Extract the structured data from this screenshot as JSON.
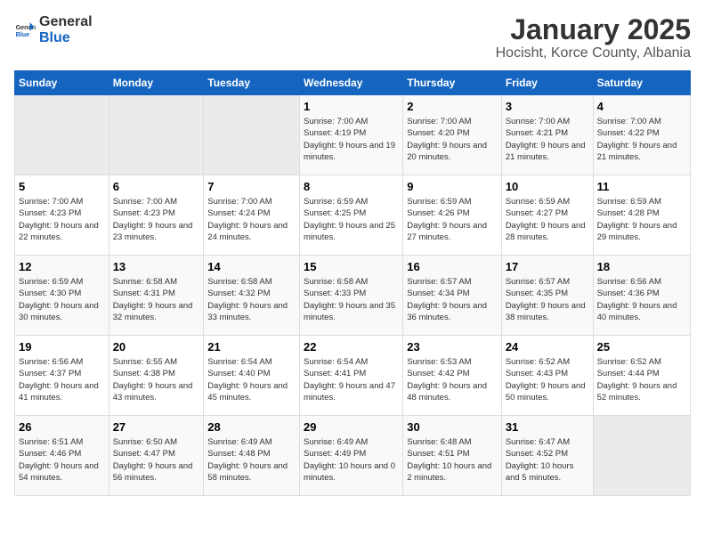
{
  "logo": {
    "general": "General",
    "blue": "Blue"
  },
  "header": {
    "title": "January 2025",
    "subtitle": "Hocisht, Korce County, Albania"
  },
  "weekdays": [
    "Sunday",
    "Monday",
    "Tuesday",
    "Wednesday",
    "Thursday",
    "Friday",
    "Saturday"
  ],
  "weeks": [
    [
      {
        "day": "",
        "empty": true
      },
      {
        "day": "",
        "empty": true
      },
      {
        "day": "",
        "empty": true
      },
      {
        "day": "1",
        "sunrise": "7:00 AM",
        "sunset": "4:19 PM",
        "daylight": "9 hours and 19 minutes."
      },
      {
        "day": "2",
        "sunrise": "7:00 AM",
        "sunset": "4:20 PM",
        "daylight": "9 hours and 20 minutes."
      },
      {
        "day": "3",
        "sunrise": "7:00 AM",
        "sunset": "4:21 PM",
        "daylight": "9 hours and 21 minutes."
      },
      {
        "day": "4",
        "sunrise": "7:00 AM",
        "sunset": "4:22 PM",
        "daylight": "9 hours and 21 minutes."
      }
    ],
    [
      {
        "day": "5",
        "sunrise": "7:00 AM",
        "sunset": "4:23 PM",
        "daylight": "9 hours and 22 minutes."
      },
      {
        "day": "6",
        "sunrise": "7:00 AM",
        "sunset": "4:23 PM",
        "daylight": "9 hours and 23 minutes."
      },
      {
        "day": "7",
        "sunrise": "7:00 AM",
        "sunset": "4:24 PM",
        "daylight": "9 hours and 24 minutes."
      },
      {
        "day": "8",
        "sunrise": "6:59 AM",
        "sunset": "4:25 PM",
        "daylight": "9 hours and 25 minutes."
      },
      {
        "day": "9",
        "sunrise": "6:59 AM",
        "sunset": "4:26 PM",
        "daylight": "9 hours and 27 minutes."
      },
      {
        "day": "10",
        "sunrise": "6:59 AM",
        "sunset": "4:27 PM",
        "daylight": "9 hours and 28 minutes."
      },
      {
        "day": "11",
        "sunrise": "6:59 AM",
        "sunset": "4:28 PM",
        "daylight": "9 hours and 29 minutes."
      }
    ],
    [
      {
        "day": "12",
        "sunrise": "6:59 AM",
        "sunset": "4:30 PM",
        "daylight": "9 hours and 30 minutes."
      },
      {
        "day": "13",
        "sunrise": "6:58 AM",
        "sunset": "4:31 PM",
        "daylight": "9 hours and 32 minutes."
      },
      {
        "day": "14",
        "sunrise": "6:58 AM",
        "sunset": "4:32 PM",
        "daylight": "9 hours and 33 minutes."
      },
      {
        "day": "15",
        "sunrise": "6:58 AM",
        "sunset": "4:33 PM",
        "daylight": "9 hours and 35 minutes."
      },
      {
        "day": "16",
        "sunrise": "6:57 AM",
        "sunset": "4:34 PM",
        "daylight": "9 hours and 36 minutes."
      },
      {
        "day": "17",
        "sunrise": "6:57 AM",
        "sunset": "4:35 PM",
        "daylight": "9 hours and 38 minutes."
      },
      {
        "day": "18",
        "sunrise": "6:56 AM",
        "sunset": "4:36 PM",
        "daylight": "9 hours and 40 minutes."
      }
    ],
    [
      {
        "day": "19",
        "sunrise": "6:56 AM",
        "sunset": "4:37 PM",
        "daylight": "9 hours and 41 minutes."
      },
      {
        "day": "20",
        "sunrise": "6:55 AM",
        "sunset": "4:38 PM",
        "daylight": "9 hours and 43 minutes."
      },
      {
        "day": "21",
        "sunrise": "6:54 AM",
        "sunset": "4:40 PM",
        "daylight": "9 hours and 45 minutes."
      },
      {
        "day": "22",
        "sunrise": "6:54 AM",
        "sunset": "4:41 PM",
        "daylight": "9 hours and 47 minutes."
      },
      {
        "day": "23",
        "sunrise": "6:53 AM",
        "sunset": "4:42 PM",
        "daylight": "9 hours and 48 minutes."
      },
      {
        "day": "24",
        "sunrise": "6:52 AM",
        "sunset": "4:43 PM",
        "daylight": "9 hours and 50 minutes."
      },
      {
        "day": "25",
        "sunrise": "6:52 AM",
        "sunset": "4:44 PM",
        "daylight": "9 hours and 52 minutes."
      }
    ],
    [
      {
        "day": "26",
        "sunrise": "6:51 AM",
        "sunset": "4:46 PM",
        "daylight": "9 hours and 54 minutes."
      },
      {
        "day": "27",
        "sunrise": "6:50 AM",
        "sunset": "4:47 PM",
        "daylight": "9 hours and 56 minutes."
      },
      {
        "day": "28",
        "sunrise": "6:49 AM",
        "sunset": "4:48 PM",
        "daylight": "9 hours and 58 minutes."
      },
      {
        "day": "29",
        "sunrise": "6:49 AM",
        "sunset": "4:49 PM",
        "daylight": "10 hours and 0 minutes."
      },
      {
        "day": "30",
        "sunrise": "6:48 AM",
        "sunset": "4:51 PM",
        "daylight": "10 hours and 2 minutes."
      },
      {
        "day": "31",
        "sunrise": "6:47 AM",
        "sunset": "4:52 PM",
        "daylight": "10 hours and 5 minutes."
      },
      {
        "day": "",
        "empty": true
      }
    ]
  ]
}
